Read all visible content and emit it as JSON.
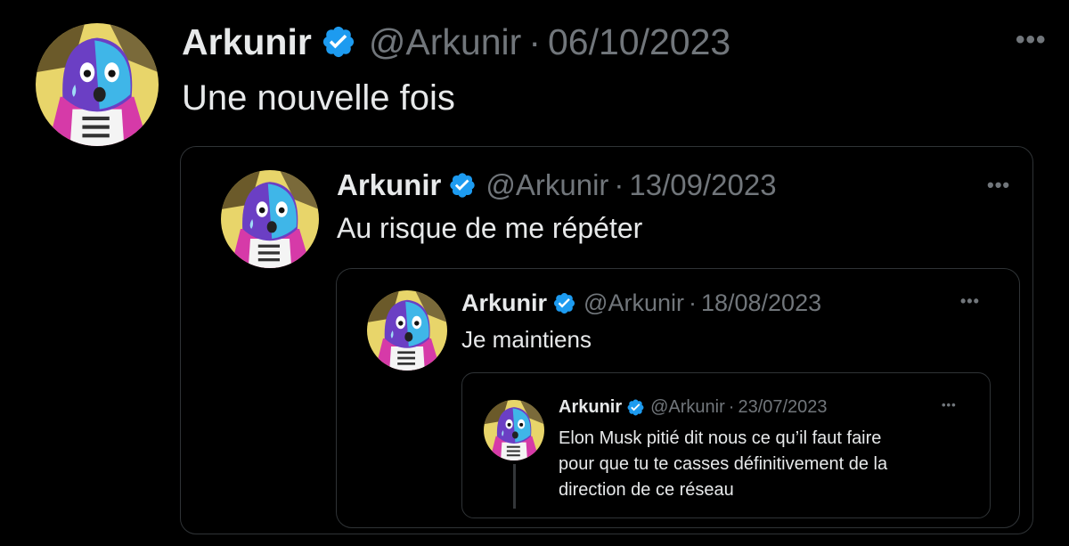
{
  "tweets": [
    {
      "name": "Arkunir",
      "handle": "@Arkunir",
      "separator": "·",
      "date": "06/10/2023",
      "text": "Une nouvelle fois",
      "more_icon": "more-horizontal-icon",
      "verified_icon": "verified-badge-icon"
    },
    {
      "name": "Arkunir",
      "handle": "@Arkunir",
      "separator": "·",
      "date": "13/09/2023",
      "text": "Au risque de me répéter",
      "more_icon": "more-horizontal-icon",
      "verified_icon": "verified-badge-icon"
    },
    {
      "name": "Arkunir",
      "handle": "@Arkunir",
      "separator": "·",
      "date": "18/08/2023",
      "text": "Je maintiens",
      "more_icon": "more-horizontal-icon",
      "verified_icon": "verified-badge-icon"
    },
    {
      "name": "Arkunir",
      "handle": "@Arkunir",
      "separator": "·",
      "date": "23/07/2023",
      "text_lines": [
        "Elon Musk pitié dit nous ce qu’il faut faire",
        "pour que tu te casses définitivement de la",
        "direction de ce réseau"
      ],
      "more_icon": "more-horizontal-icon",
      "verified_icon": "verified-badge-icon"
    }
  ],
  "colors": {
    "background": "#000000",
    "text_primary": "#e7e9ea",
    "text_secondary": "#71767b",
    "verified_blue": "#1d9bf0",
    "border": "#2f3336"
  }
}
